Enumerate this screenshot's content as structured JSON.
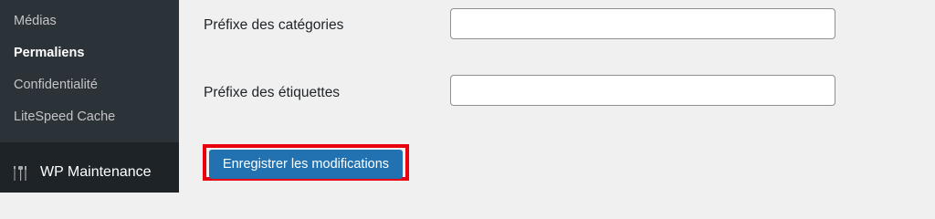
{
  "sidebar": {
    "submenu_items": [
      {
        "label": "Médias",
        "current": false
      },
      {
        "label": "Permaliens",
        "current": true
      },
      {
        "label": "Confidentialité",
        "current": false
      },
      {
        "label": "LiteSpeed Cache",
        "current": false
      }
    ],
    "menu_item": {
      "label": "WP Maintenance",
      "icon": "maintenance-tools-icon"
    }
  },
  "form": {
    "category_base": {
      "label": "Préfixe des catégories",
      "value": "",
      "placeholder": ""
    },
    "tag_base": {
      "label": "Préfixe des étiquettes",
      "value": "",
      "placeholder": ""
    },
    "submit_label": "Enregistrer les modifications"
  },
  "colors": {
    "sidebar_bg": "#2c3338",
    "menu_bg": "#1d2327",
    "content_bg": "#f0f0f1",
    "primary": "#2271b1",
    "highlight": "#e8000f"
  }
}
